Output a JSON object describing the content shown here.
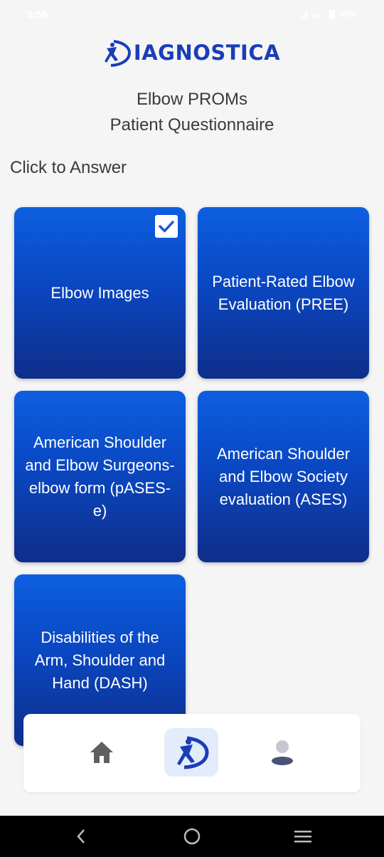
{
  "status_bar": {
    "time": "9:56",
    "battery": "60%"
  },
  "header": {
    "brand": "IAGNOSTICA",
    "title_line1": "Elbow PROMs",
    "title_line2": "Patient Questionnaire"
  },
  "main": {
    "prompt": "Click to Answer",
    "cards": [
      {
        "label": "Elbow Images",
        "checked": true
      },
      {
        "label": "Patient-Rated Elbow Evaluation (PREE)",
        "checked": false
      },
      {
        "label": "American Shoulder and Elbow Surgeons-elbow form (pASES-e)",
        "checked": false
      },
      {
        "label": "American Shoulder and Elbow Society evaluation (ASES)",
        "checked": false
      },
      {
        "label": "Disabilities of the Arm, Shoulder and Hand (DASH)",
        "checked": false
      }
    ]
  },
  "bottom_nav": {
    "items": [
      "home-icon",
      "diagnostica-logo-icon",
      "profile-icon"
    ],
    "active": "diagnostica-logo-icon"
  },
  "colors": {
    "brand": "#1a3db8",
    "card_top": "#0d5fe0",
    "card_bottom": "#0f2e8a",
    "nav_active_bg": "#e3ecfb"
  }
}
